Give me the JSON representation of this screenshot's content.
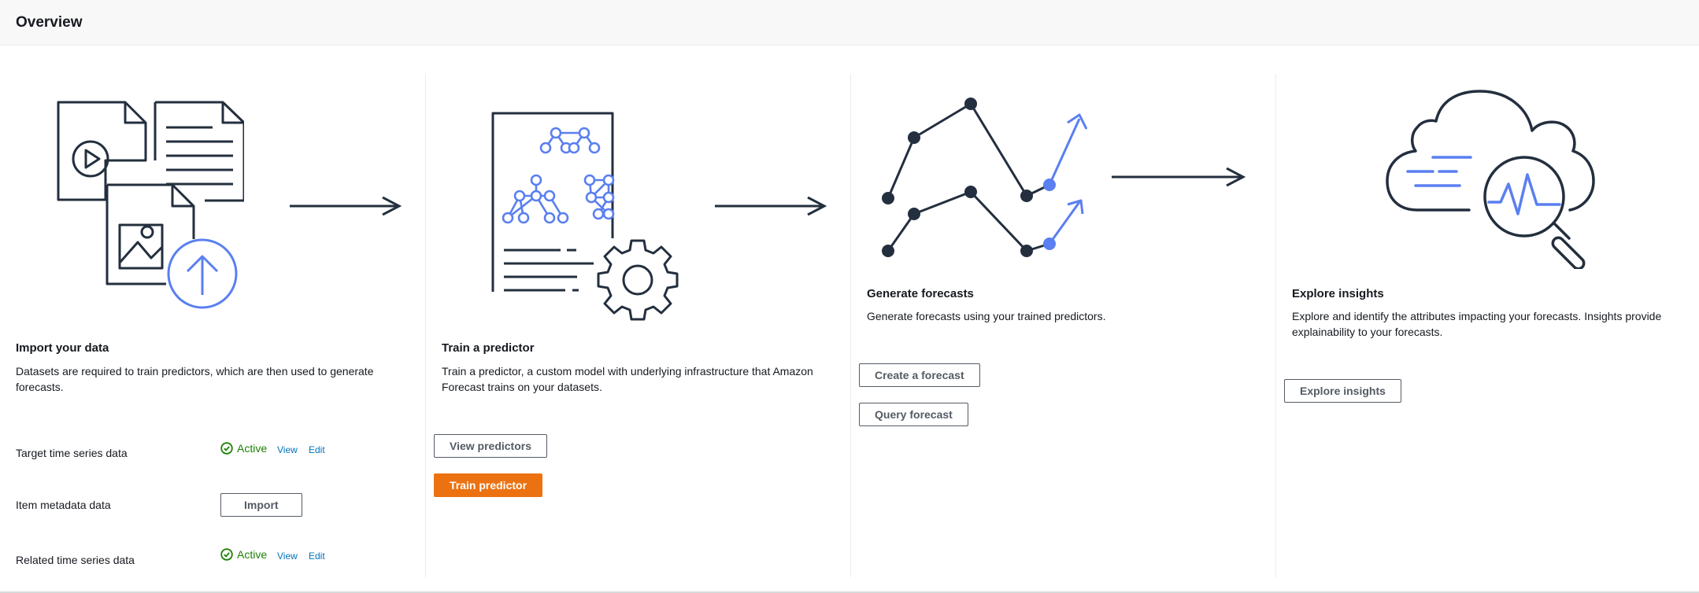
{
  "header": {
    "title": "Overview"
  },
  "colors": {
    "accent_blue": "#5a7ff0",
    "dark": "#232f3e",
    "primary_button": "#ec7211",
    "active_green": "#1d8102",
    "link": "#0073bb"
  },
  "import_card": {
    "title": "Import your data",
    "description": "Datasets are required to train predictors, which are then used to generate forecasts.",
    "datasets": [
      {
        "label": "Target time series data",
        "status": "Active",
        "view": "View",
        "edit": "Edit"
      },
      {
        "label": "Item metadata data",
        "action": "Import"
      },
      {
        "label": "Related time series data",
        "status": "Active",
        "view": "View",
        "edit": "Edit"
      }
    ]
  },
  "train_card": {
    "title": "Train a predictor",
    "description": "Train a predictor, a custom model with underlying infrastructure that Amazon Forecast trains on your datasets.",
    "view_button": "View predictors",
    "train_button": "Train predictor"
  },
  "forecast_card": {
    "title": "Generate forecasts",
    "description": "Generate forecasts using your trained predictors.",
    "create_button": "Create a forecast",
    "query_button": "Query forecast"
  },
  "insights_card": {
    "title": "Explore insights",
    "description": "Explore and identify the attributes impacting your forecasts. Insights provide explainability to your forecasts.",
    "explore_button": "Explore insights"
  },
  "icons": [
    "documents-upload-icon",
    "arrow-right-icon",
    "predictor-model-icon",
    "forecast-chart-icon",
    "cloud-insights-icon",
    "check-circle-icon"
  ]
}
